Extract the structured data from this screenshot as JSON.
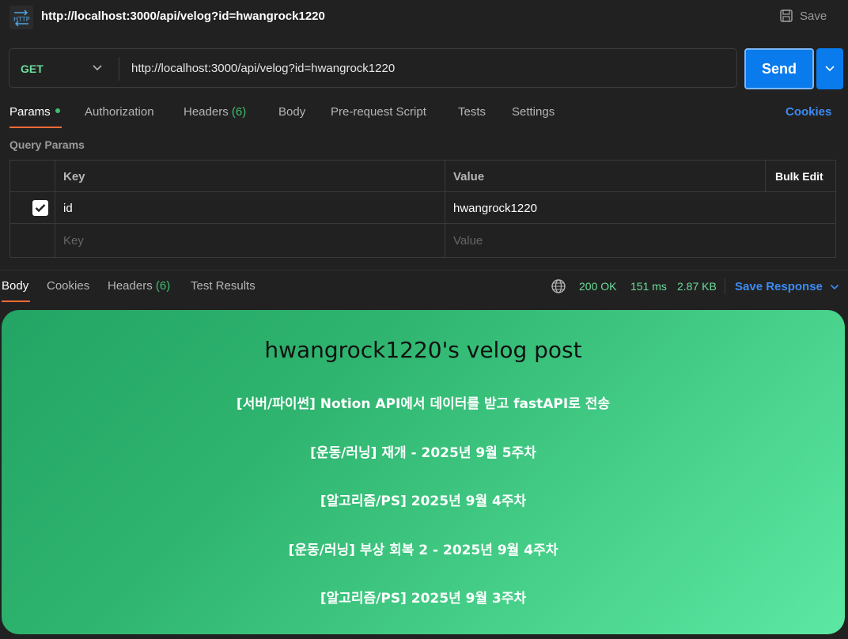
{
  "titlebar": {
    "icon": "http-icon",
    "title": "http://localhost:3000/api/velog?id=hwangrock1220",
    "save_label": "Save"
  },
  "request": {
    "method": "GET",
    "url": "http://localhost:3000/api/velog?id=hwangrock1220",
    "send_label": "Send"
  },
  "request_tabs": {
    "params": "Params",
    "authorization": "Authorization",
    "headers": "Headers",
    "headers_count": "(6)",
    "body": "Body",
    "pre_request": "Pre-request Script",
    "tests": "Tests",
    "settings": "Settings",
    "cookies": "Cookies"
  },
  "query_params": {
    "title": "Query Params",
    "col_key": "Key",
    "col_value": "Value",
    "bulk_edit": "Bulk Edit",
    "rows": [
      {
        "checked": true,
        "key": "id",
        "value": "hwangrock1220"
      }
    ],
    "placeholder_key": "Key",
    "placeholder_value": "Value"
  },
  "response_tabs": {
    "body": "Body",
    "cookies": "Cookies",
    "headers": "Headers",
    "headers_count": "(6)",
    "test_results": "Test Results"
  },
  "response_status": {
    "code": "200 OK",
    "time": "151 ms",
    "size": "2.87 KB",
    "save_response": "Save Response"
  },
  "preview": {
    "title": "hwangrock1220's velog post",
    "posts": [
      "[서버/파이썬] Notion API에서 데이터를 받고 fastAPI로 전송",
      "[운동/러닝] 재개 - 2025년 9월 5주차",
      "[알고리즘/PS] 2025년 9월 4주차",
      "[운동/러닝] 부상 회복 2 - 2025년 9월 4주차",
      "[알고리즘/PS] 2025년 9월 3주차"
    ]
  },
  "colors": {
    "accent_blue": "#097bed",
    "tab_underline": "#ff6c37",
    "status_green": "#6bdd9a",
    "link_blue": "#3d8bf2"
  }
}
